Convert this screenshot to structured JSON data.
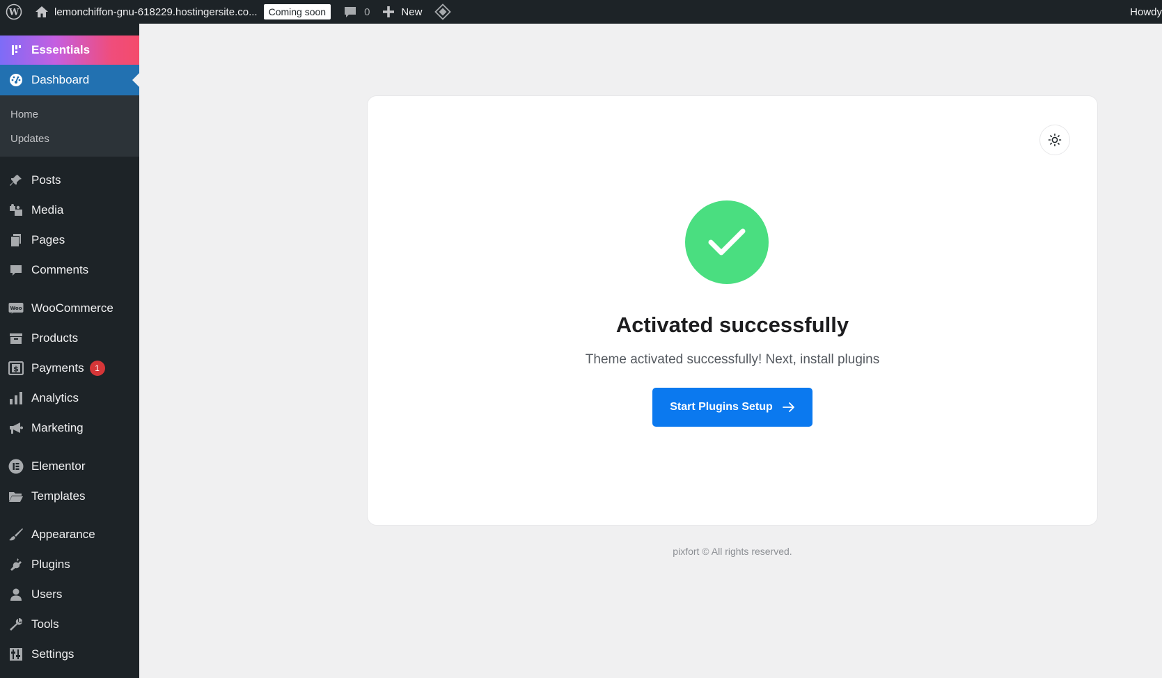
{
  "adminbar": {
    "site_name": "lemonchiffon-gnu-618229.hostingersite.co...",
    "status_badge": "Coming soon",
    "comments_count": "0",
    "new_label": "New",
    "howdy": "Howdy"
  },
  "sidebar": {
    "essentials": "Essentials",
    "dashboard": "Dashboard",
    "dashboard_sub": [
      "Home",
      "Updates"
    ],
    "items": [
      {
        "label": "Posts",
        "icon": "pin-icon"
      },
      {
        "label": "Media",
        "icon": "media-icon"
      },
      {
        "label": "Pages",
        "icon": "pages-icon"
      },
      {
        "label": "Comments",
        "icon": "comment-icon"
      },
      {
        "label": "WooCommerce",
        "icon": "woo-icon"
      },
      {
        "label": "Products",
        "icon": "archive-icon"
      },
      {
        "label": "Payments",
        "icon": "dollar-icon",
        "badge": "1"
      },
      {
        "label": "Analytics",
        "icon": "bar-chart-icon"
      },
      {
        "label": "Marketing",
        "icon": "megaphone-icon"
      },
      {
        "label": "Elementor",
        "icon": "elementor-icon"
      },
      {
        "label": "Templates",
        "icon": "folder-icon"
      },
      {
        "label": "Appearance",
        "icon": "brush-icon"
      },
      {
        "label": "Plugins",
        "icon": "plugin-icon"
      },
      {
        "label": "Users",
        "icon": "user-icon"
      },
      {
        "label": "Tools",
        "icon": "wrench-icon"
      },
      {
        "label": "Settings",
        "icon": "settings-icon"
      }
    ]
  },
  "main": {
    "title": "Activated successfully",
    "subtitle": "Theme activated successfully! Next, install plugins",
    "cta_label": "Start Plugins Setup",
    "footer": "pixfort © All rights reserved."
  },
  "colors": {
    "success": "#4ade80",
    "primary": "#0b79ef",
    "admin_dark": "#1d2327",
    "dashboard_active": "#2271b1",
    "badge_red": "#d63638"
  }
}
